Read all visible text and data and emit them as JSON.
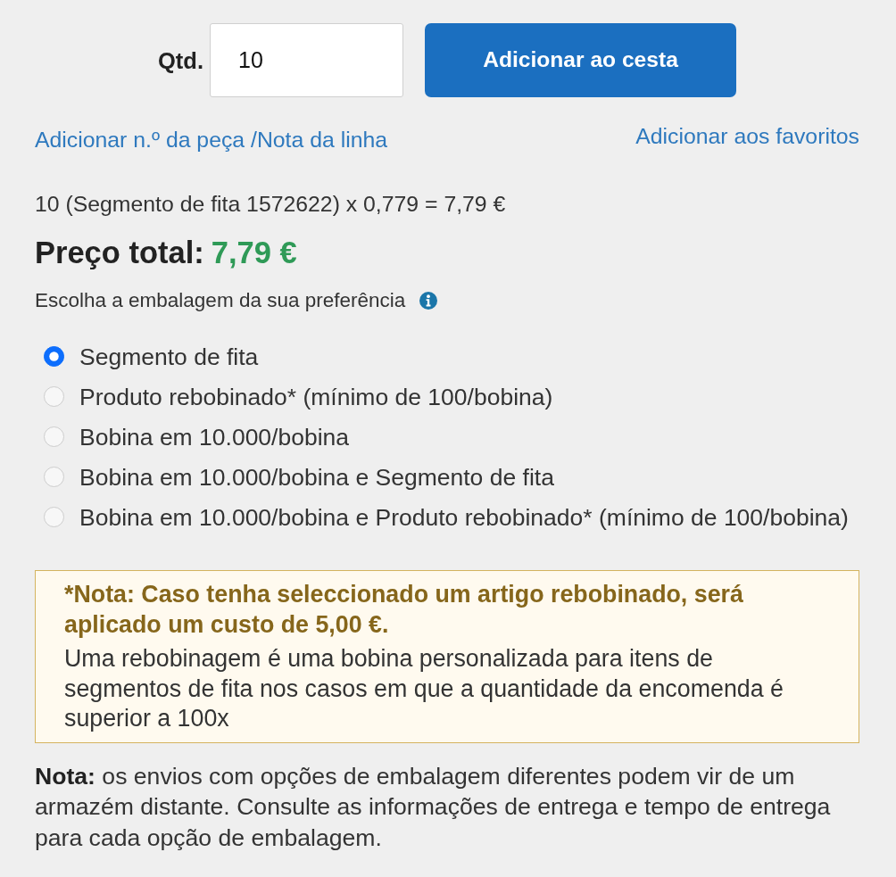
{
  "quantity": {
    "label": "Qtd.",
    "value": "10"
  },
  "add_button": {
    "label": "Adicionar ao cesta"
  },
  "links": [
    {
      "label": "Adicionar n.º da peça /Nota da linha"
    },
    {
      "label": "Adicionar aos favoritos"
    }
  ],
  "calculation": "10 (Segmento de fita 1572622) x 0,779 = 7,79 €",
  "total": {
    "label": "Preço total:",
    "value": "7,79 €"
  },
  "packaging": {
    "prompt": "Escolha a embalagem da sua preferência",
    "options": [
      {
        "label": "Segmento de fita",
        "selected": true
      },
      {
        "label": "Produto rebobinado* (mínimo de 100/bobina)",
        "selected": false
      },
      {
        "label": "Bobina em 10.000/bobina",
        "selected": false
      },
      {
        "label": "Bobina em 10.000/bobina e Segmento de fita",
        "selected": false
      },
      {
        "label": "Bobina em 10.000/bobina e Produto rebobinado* (mínimo de 100/bobina)",
        "selected": false
      }
    ]
  },
  "rewind_note": {
    "title": "*Nota: Caso tenha seleccionado um artigo rebobinado, será aplicado um custo de 5,00 €.",
    "body": "Uma rebobinagem é uma bobina personalizada para itens de segmentos de fita nos casos em que a quantidade da encomenda é superior a 100x"
  },
  "footer_note": "**Nota:** os envios com opções de embalagem diferentes podem vir de um armazém distante. Consulte as informações de entrega e tempo de entrega para cada opção de embalagem."
}
